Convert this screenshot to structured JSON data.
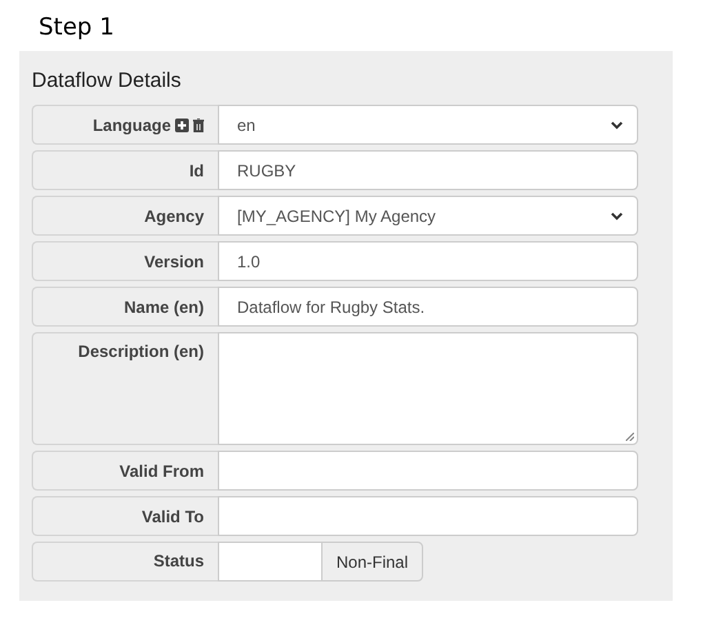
{
  "step_title": "Step 1",
  "panel": {
    "title": "Dataflow Details",
    "rows": [
      {
        "kind": "select",
        "label": "Language",
        "icons": true,
        "value": "en"
      },
      {
        "kind": "text",
        "label": "Id",
        "value": "RUGBY"
      },
      {
        "kind": "select",
        "label": "Agency",
        "value": "[MY_AGENCY] My Agency"
      },
      {
        "kind": "text",
        "label": "Version",
        "value": "1.0"
      },
      {
        "kind": "text",
        "label": "Name (en)",
        "value": "Dataflow for Rugby Stats."
      },
      {
        "kind": "textarea",
        "label": "Description (en)"
      },
      {
        "kind": "text",
        "label": "Valid From"
      },
      {
        "kind": "text",
        "label": "Valid To"
      },
      {
        "kind": "status",
        "label": "Status",
        "button": "Non-Final"
      }
    ]
  }
}
